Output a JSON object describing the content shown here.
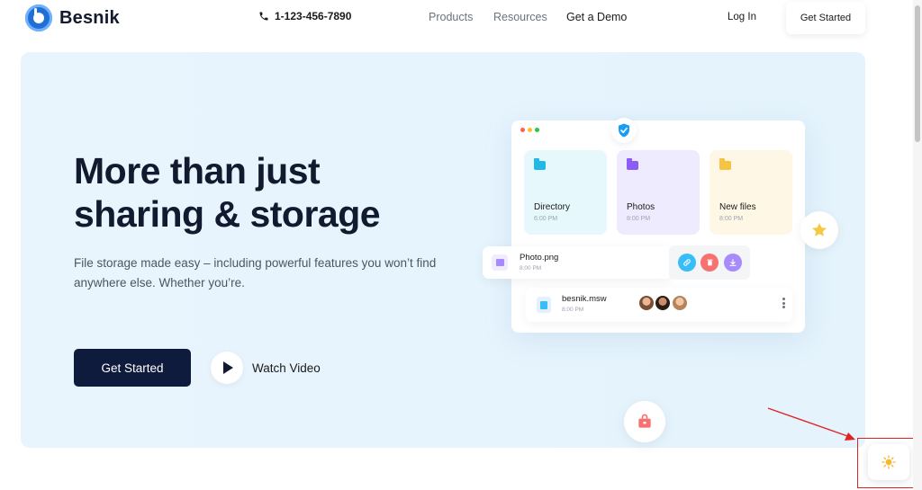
{
  "header": {
    "brand": "Besnik",
    "phone": "1-123-456-7890",
    "nav": [
      "Products",
      "Resources",
      "Get a Demo"
    ],
    "login": "Log In",
    "cta": "Get Started"
  },
  "hero": {
    "title_line1": "More than just",
    "title_line2": "sharing & storage",
    "subtitle": "File storage made easy – including powerful features you won’t find anywhere else. Whether you’re.",
    "primary_cta": "Get Started",
    "secondary_cta": "Watch Video"
  },
  "mockup": {
    "folders": [
      {
        "name": "Directory",
        "time": "6:00 PM",
        "bg": "#e6f8fb",
        "icon_color": "#22b8e6"
      },
      {
        "name": "Photos",
        "time": "8:00 PM",
        "bg": "#efebff",
        "icon_color": "#8b5cf6"
      },
      {
        "name": "New files",
        "time": "8:00 PM",
        "bg": "#fff7e6",
        "icon_color": "#f5c542"
      }
    ],
    "photo_file": {
      "name": "Photo.png",
      "time": "8:00 PM"
    },
    "doc_file": {
      "name": "besnik.msw",
      "time": "8:00 PM"
    },
    "action_icons": [
      "link-icon",
      "trash-icon",
      "download-icon"
    ],
    "action_colors": [
      "#38bdf8",
      "#f87171",
      "#a78bfa"
    ]
  },
  "colors": {
    "accent_dark": "#0f1b3d",
    "hero_bg": "#e7f4fd",
    "annotation": "#e02424"
  },
  "icons": {
    "phone": "phone-icon",
    "shield": "shield-check-icon",
    "star": "star-icon",
    "bag": "shopping-bag-icon",
    "theme": "sun-icon",
    "play": "play-icon"
  }
}
